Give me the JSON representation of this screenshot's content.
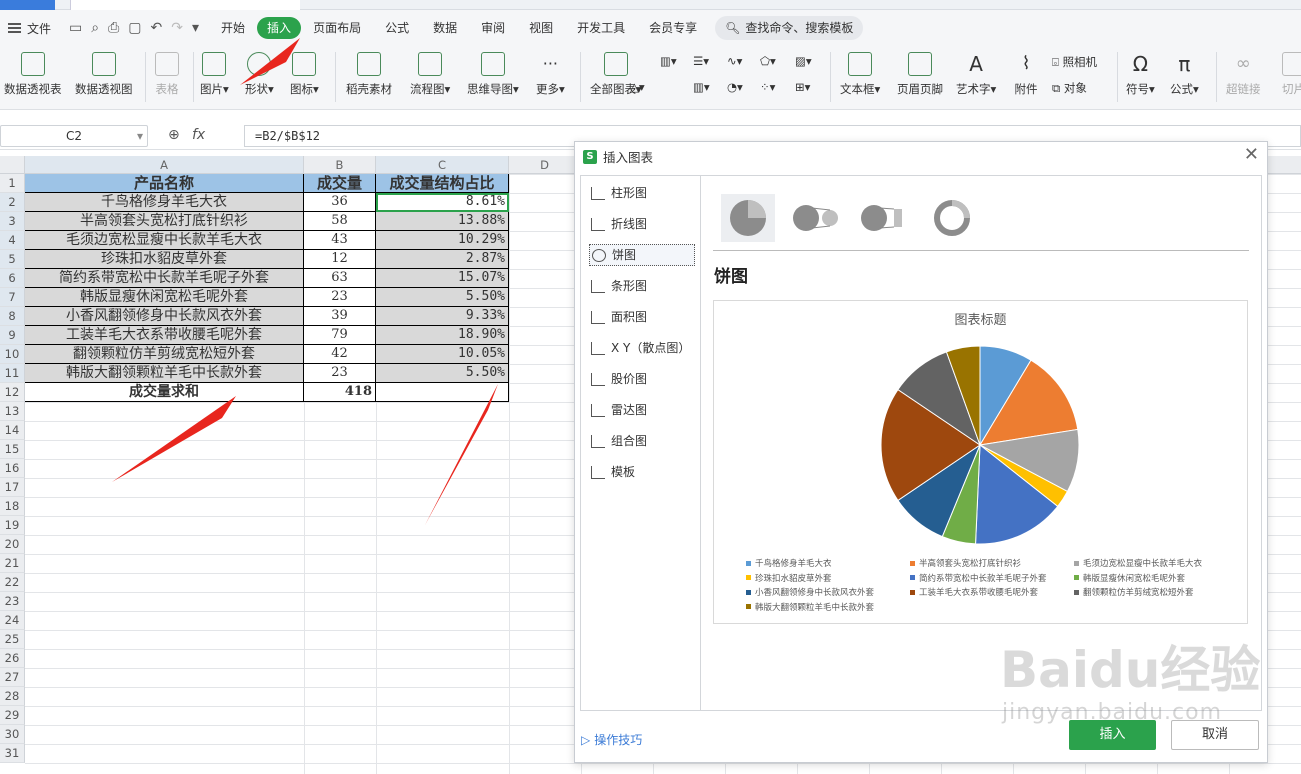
{
  "menubar": {
    "file_label": "文件",
    "tabs": [
      "开始",
      "插入",
      "页面布局",
      "公式",
      "数据",
      "审阅",
      "视图",
      "开发工具",
      "会员专享"
    ],
    "active_tab": "插入",
    "search_placeholder": "查找命令、搜索模板"
  },
  "ribbon": {
    "pivot_table": "数据透视表",
    "pivot_chart": "数据透视图",
    "table": "表格",
    "picture": "图片",
    "shape": "形状",
    "icon": "图标",
    "daoke": "稻壳素材",
    "flowchart": "流程图",
    "mindmap": "思维导图",
    "more": "更多",
    "all_charts": "全部图表",
    "textbox": "文本框",
    "header_footer": "页眉页脚",
    "wordart": "艺术字",
    "attachment": "附件",
    "camera": "照相机",
    "object": "对象",
    "symbol": "符号",
    "formula": "公式",
    "hyperlink": "超链接",
    "cut": "切片"
  },
  "formula_bar": {
    "name_box": "C2",
    "fx": "fx",
    "formula": "=B2/$B$12"
  },
  "sheet": {
    "columns": [
      "A",
      "B",
      "C",
      "D"
    ],
    "row_numbers": [
      "1",
      "2",
      "3",
      "4",
      "5",
      "6",
      "7",
      "8",
      "9",
      "10",
      "11",
      "12",
      "13",
      "14",
      "15",
      "16",
      "17",
      "18",
      "19",
      "20",
      "21",
      "22",
      "23",
      "24",
      "25",
      "26",
      "27",
      "28",
      "29",
      "30",
      "31"
    ],
    "header": {
      "a": "产品名称",
      "b": "成交量",
      "c": "成交量结构占比"
    },
    "rows": [
      {
        "a": "千鸟格修身羊毛大衣",
        "b": "36",
        "c": "8.61%"
      },
      {
        "a": "半高领套头宽松打底针织衫",
        "b": "58",
        "c": "13.88%"
      },
      {
        "a": "毛须边宽松显瘦中长款羊毛大衣",
        "b": "43",
        "c": "10.29%"
      },
      {
        "a": "珍珠扣水貂皮草外套",
        "b": "12",
        "c": "2.87%"
      },
      {
        "a": "简约系带宽松中长款羊毛呢子外套",
        "b": "63",
        "c": "15.07%"
      },
      {
        "a": "韩版显瘦休闲宽松毛呢外套",
        "b": "23",
        "c": "5.50%"
      },
      {
        "a": "小香风翻领修身中长款风衣外套",
        "b": "39",
        "c": "9.33%"
      },
      {
        "a": "工装羊毛大衣系带收腰毛呢外套",
        "b": "79",
        "c": "18.90%"
      },
      {
        "a": "翻领颗粒仿羊剪绒宽松短外套",
        "b": "42",
        "c": "10.05%"
      },
      {
        "a": "韩版大翻领颗粒羊毛中长款外套",
        "b": "23",
        "c": "5.50%"
      }
    ],
    "sum_row": {
      "a": "成交量求和",
      "b": "418",
      "c": ""
    }
  },
  "dialog": {
    "title": "插入图表",
    "categories": [
      "柱形图",
      "折线图",
      "饼图",
      "条形图",
      "面积图",
      "X Y（散点图）",
      "股价图",
      "雷达图",
      "组合图",
      "模板"
    ],
    "selected_category": "饼图",
    "chart_type_heading": "饼图",
    "tips_link": "操作技巧",
    "insert_button": "插入",
    "cancel_button": "取消"
  },
  "chart_data": {
    "type": "pie",
    "title": "图表标题",
    "categories": [
      "千鸟格修身羊毛大衣",
      "半高领套头宽松打底针织衫",
      "毛须边宽松显瘦中长款羊毛大衣",
      "珍珠扣水貂皮草外套",
      "简约系带宽松中长款羊毛呢子外套",
      "韩版显瘦休闲宽松毛呢外套",
      "小香风翻领修身中长款风衣外套",
      "工装羊毛大衣系带收腰毛呢外套",
      "翻领颗粒仿羊剪绒宽松短外套",
      "韩版大翻领颗粒羊毛中长款外套"
    ],
    "values": [
      36,
      58,
      43,
      12,
      63,
      23,
      39,
      79,
      42,
      23
    ],
    "colors": [
      "#5b9bd5",
      "#ed7d31",
      "#a5a5a5",
      "#ffc000",
      "#4472c4",
      "#70ad47",
      "#255e91",
      "#9e480e",
      "#636363",
      "#997300"
    ],
    "legend_position": "bottom"
  },
  "watermark": {
    "logo": "Baidu经验",
    "url": "jingyan.baidu.com"
  }
}
